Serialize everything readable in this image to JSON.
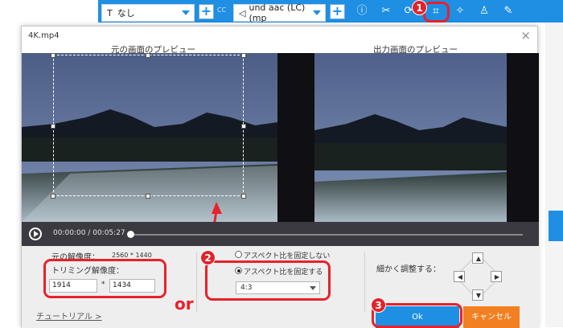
{
  "toolbar": {
    "subtitle_select": "なし",
    "audio_select": "und aac (LC) (mp",
    "plus_label": "+",
    "cc_label": "CC"
  },
  "dialog": {
    "title": "4K.mp4",
    "close": "×",
    "original_preview_label": "元の画面のプレビュー",
    "output_preview_label": "出力画面のプレビュー",
    "current_time": "00:00:00",
    "time_separator": "/",
    "duration": "00:05:27",
    "original_resolution_label": "元の解像度：",
    "original_resolution_value": "2560 * 1440",
    "trim_resolution_label": "トリミング解像度：",
    "trim_width": "1914",
    "trim_separator": "*",
    "trim_height": "1434",
    "or_label": "or",
    "radio_free": "アスペクト比を固定しない",
    "radio_fixed": "アスペクト比を固定する",
    "aspect_ratio": "4:3",
    "fine_adjust_label": "細かく調整する：",
    "tutorial_link": "チュートリアル >",
    "ok_label": "Ok",
    "cancel_label": "キャンセル"
  },
  "annotations": {
    "badge_1": "1",
    "badge_2": "2",
    "badge_3": "3",
    "color": "#e8212b"
  },
  "colors": {
    "accent": "#1e8fe3",
    "cancel": "#f27f21",
    "controls_bg": "#3a3a40"
  }
}
